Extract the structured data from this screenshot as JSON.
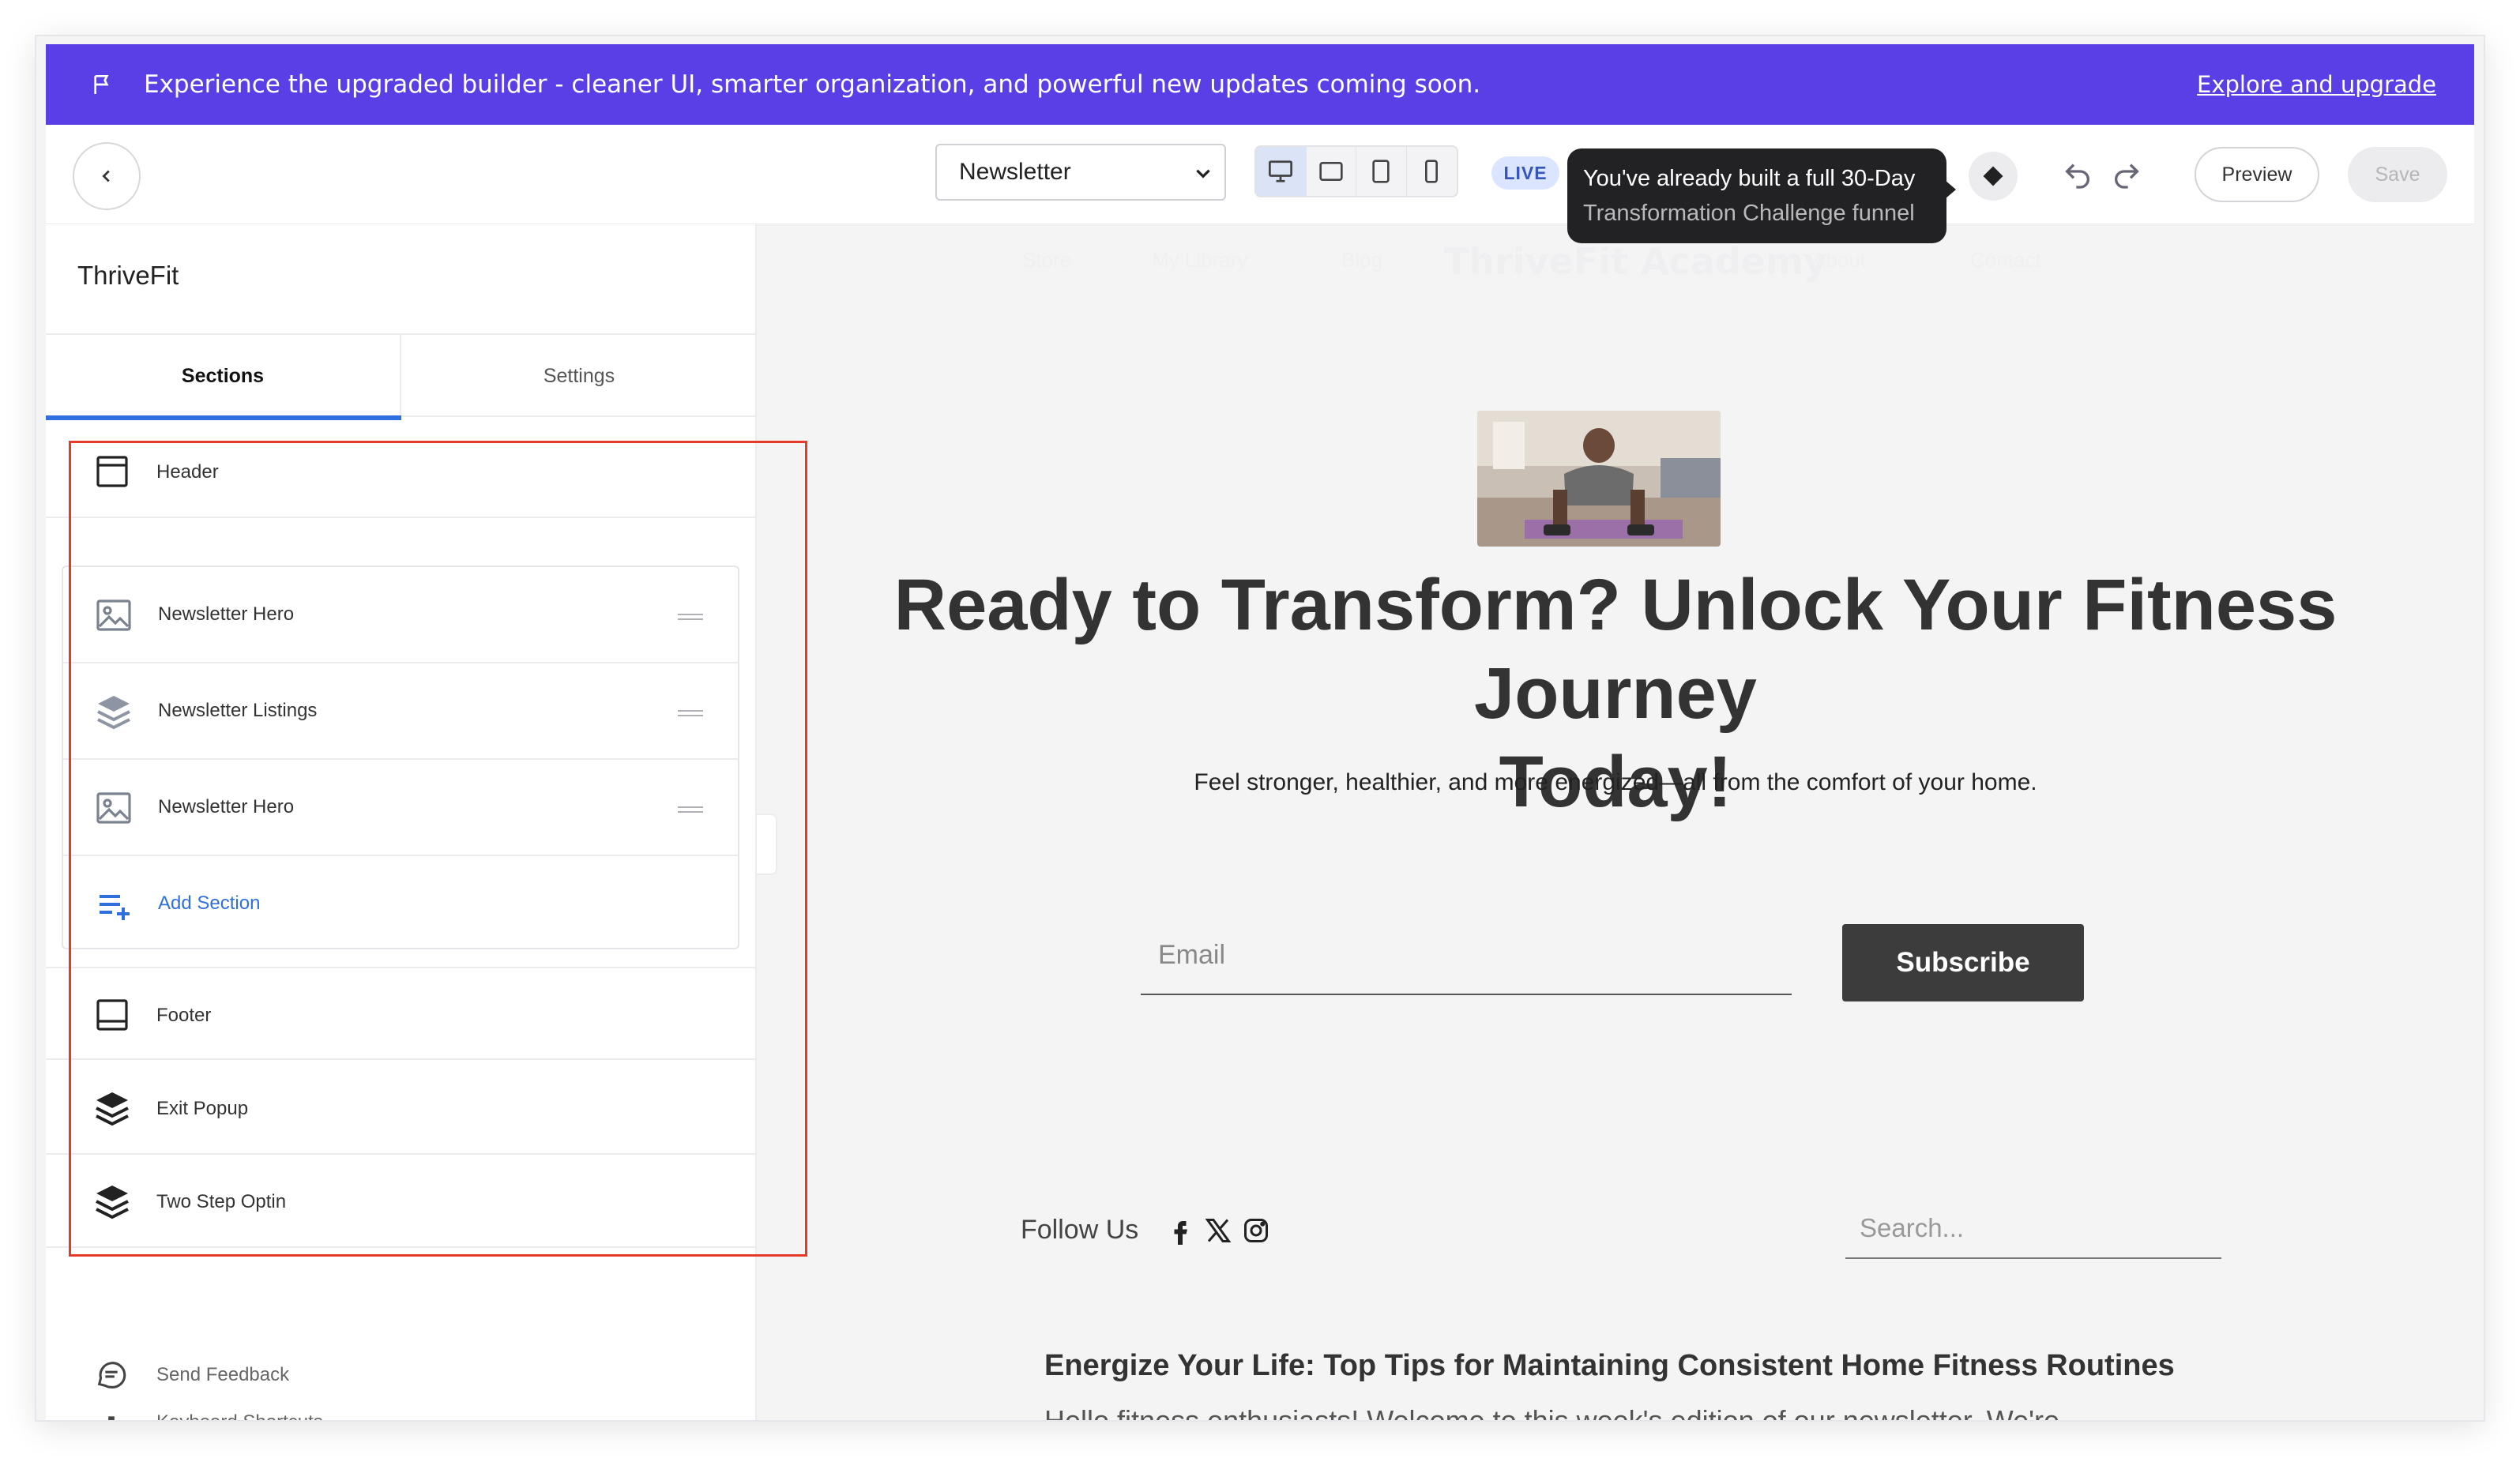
{
  "banner": {
    "message": "Experience the upgraded builder - cleaner UI, smarter organization, and powerful new updates coming soon.",
    "link": "Explore and upgrade",
    "color": "#5b3fe6"
  },
  "toolbar": {
    "page_select": "Newsletter",
    "devices": [
      "desktop-icon",
      "tablet-landscape-icon",
      "tablet-portrait-icon",
      "mobile-icon"
    ],
    "live_badge": "LIVE",
    "tooltip_line1": "You've already built a full 30-Day",
    "tooltip_line2": "Transformation Challenge funnel",
    "preview": "Preview",
    "save": "Save"
  },
  "sidebar": {
    "brand": "ThriveFit",
    "tabs": [
      "Sections",
      "Settings"
    ],
    "header": "Header",
    "group_items": [
      "Newsletter Hero",
      "Newsletter Listings",
      "Newsletter Hero"
    ],
    "add_section": "Add Section",
    "footer": "Footer",
    "exit_popup": "Exit Popup",
    "two_step_optin": "Two Step Optin",
    "send_feedback": "Send Feedback",
    "keyboard_shortcuts": "Keyboard Shortcuts"
  },
  "canvas": {
    "nav": [
      "Store",
      "My Library",
      "Blog",
      "About",
      "Contact"
    ],
    "logo": "ThriveFit Academy",
    "headline_line1": "Ready to Transform? Unlock Your Fitness Journey",
    "headline_line2": "Today!",
    "subheadline": "Feel stronger, healthier, and more energized—all from the comfort of your home.",
    "email_placeholder": "Email",
    "subscribe": "Subscribe",
    "follow_us": "Follow Us",
    "search_placeholder": "Search...",
    "article_title": "Energize Your Life: Top Tips for Maintaining Consistent Home Fitness Routines",
    "article_body": "Hello fitness enthusiasts! Welcome to this week's edition of our newsletter. We're"
  }
}
